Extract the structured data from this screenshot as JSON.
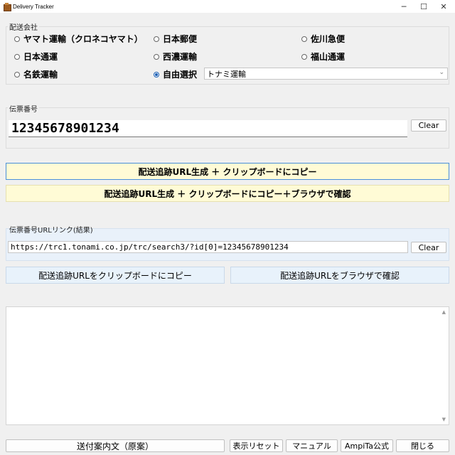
{
  "window": {
    "title": "Delivery Tracker",
    "minimize": "─",
    "maximize": "☐",
    "close": "✕"
  },
  "carrier_group": {
    "label": "配送会社",
    "options": [
      {
        "label": "ヤマト運輸（クロネコヤマト）",
        "checked": false
      },
      {
        "label": "日本郵便",
        "checked": false
      },
      {
        "label": "佐川急便",
        "checked": false
      },
      {
        "label": "日本通運",
        "checked": false
      },
      {
        "label": "西濃運輸",
        "checked": false
      },
      {
        "label": "福山通運",
        "checked": false
      },
      {
        "label": "名鉄運輸",
        "checked": false
      },
      {
        "label": "自由選択",
        "checked": true
      }
    ],
    "free_select_value": "トナミ運輸",
    "chevron": "⌄"
  },
  "tracking_group": {
    "label": "伝票番号",
    "value": "12345678901234",
    "clear_label": "Clear"
  },
  "actions": {
    "generate_copy": "配送追跡URL生成 ＋ クリップボードにコピー",
    "generate_copy_browse": "配送追跡URL生成 ＋ クリップボードにコピー＋ブラウザで確認"
  },
  "result_group": {
    "label": "伝票番号URLリンク(結果)",
    "url": "https://trc1.tonami.co.jp/trc/search3/?id[0]=12345678901234",
    "clear_label": "Clear",
    "copy_label": "配送追跡URLをクリップボードにコピー",
    "browse_label": "配送追跡URLをブラウザで確認"
  },
  "scroll": {
    "up": "▲",
    "down": "▼"
  },
  "footer": {
    "guide": "送付案内文（原案）",
    "reset": "表示リセット",
    "manual": "マニュアル",
    "official": "AmpiTa公式",
    "close": "閉じる"
  }
}
